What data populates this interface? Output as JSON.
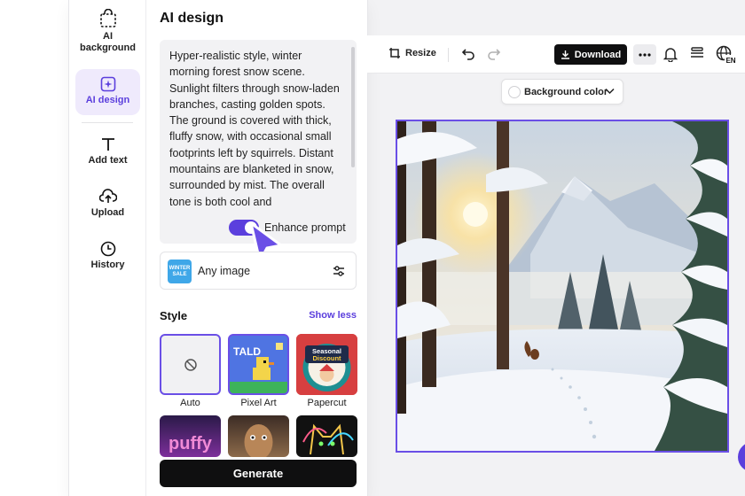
{
  "rail": {
    "items": [
      {
        "label": "AI background",
        "icon": "ai-background-icon"
      },
      {
        "label": "AI design",
        "icon": "ai-design-icon",
        "active": true
      },
      {
        "label": "Add text",
        "icon": "text-icon"
      },
      {
        "label": "Upload",
        "icon": "upload-icon"
      },
      {
        "label": "History",
        "icon": "clock-icon"
      }
    ]
  },
  "side": {
    "title": "AI design",
    "prompt": "Hyper-realistic style, winter morning forest snow scene. Sunlight filters through snow-laden branches, casting golden spots. The ground is covered with thick, fluffy snow, with occasional small footprints left by squirrels. Distant mountains are blanketed in snow, surrounded by mist. The overall tone is both cool and",
    "enhance_label": "Enhance prompt",
    "enhance_on": true,
    "any_image": {
      "label": "Any image",
      "thumb_text": "WINTER SALE"
    },
    "style_heading": "Style",
    "show_less": "Show less",
    "styles": [
      {
        "label": "Auto",
        "selected": true
      },
      {
        "label": "Pixel Art"
      },
      {
        "label": "Papercut"
      },
      {
        "label": ""
      },
      {
        "label": ""
      },
      {
        "label": ""
      }
    ],
    "pixel_text": "TALD",
    "papercut_text": "Seasonal Discount",
    "puffy_text": "puffy",
    "generate": "Generate"
  },
  "toolbar": {
    "resize": "Resize",
    "download": "Download",
    "lang_badge": "EN"
  },
  "background_color": {
    "label": "Background color"
  },
  "colors": {
    "accent": "#5b3fdd",
    "dark": "#0f0f10",
    "panel_bg": "#f2f2f4"
  }
}
